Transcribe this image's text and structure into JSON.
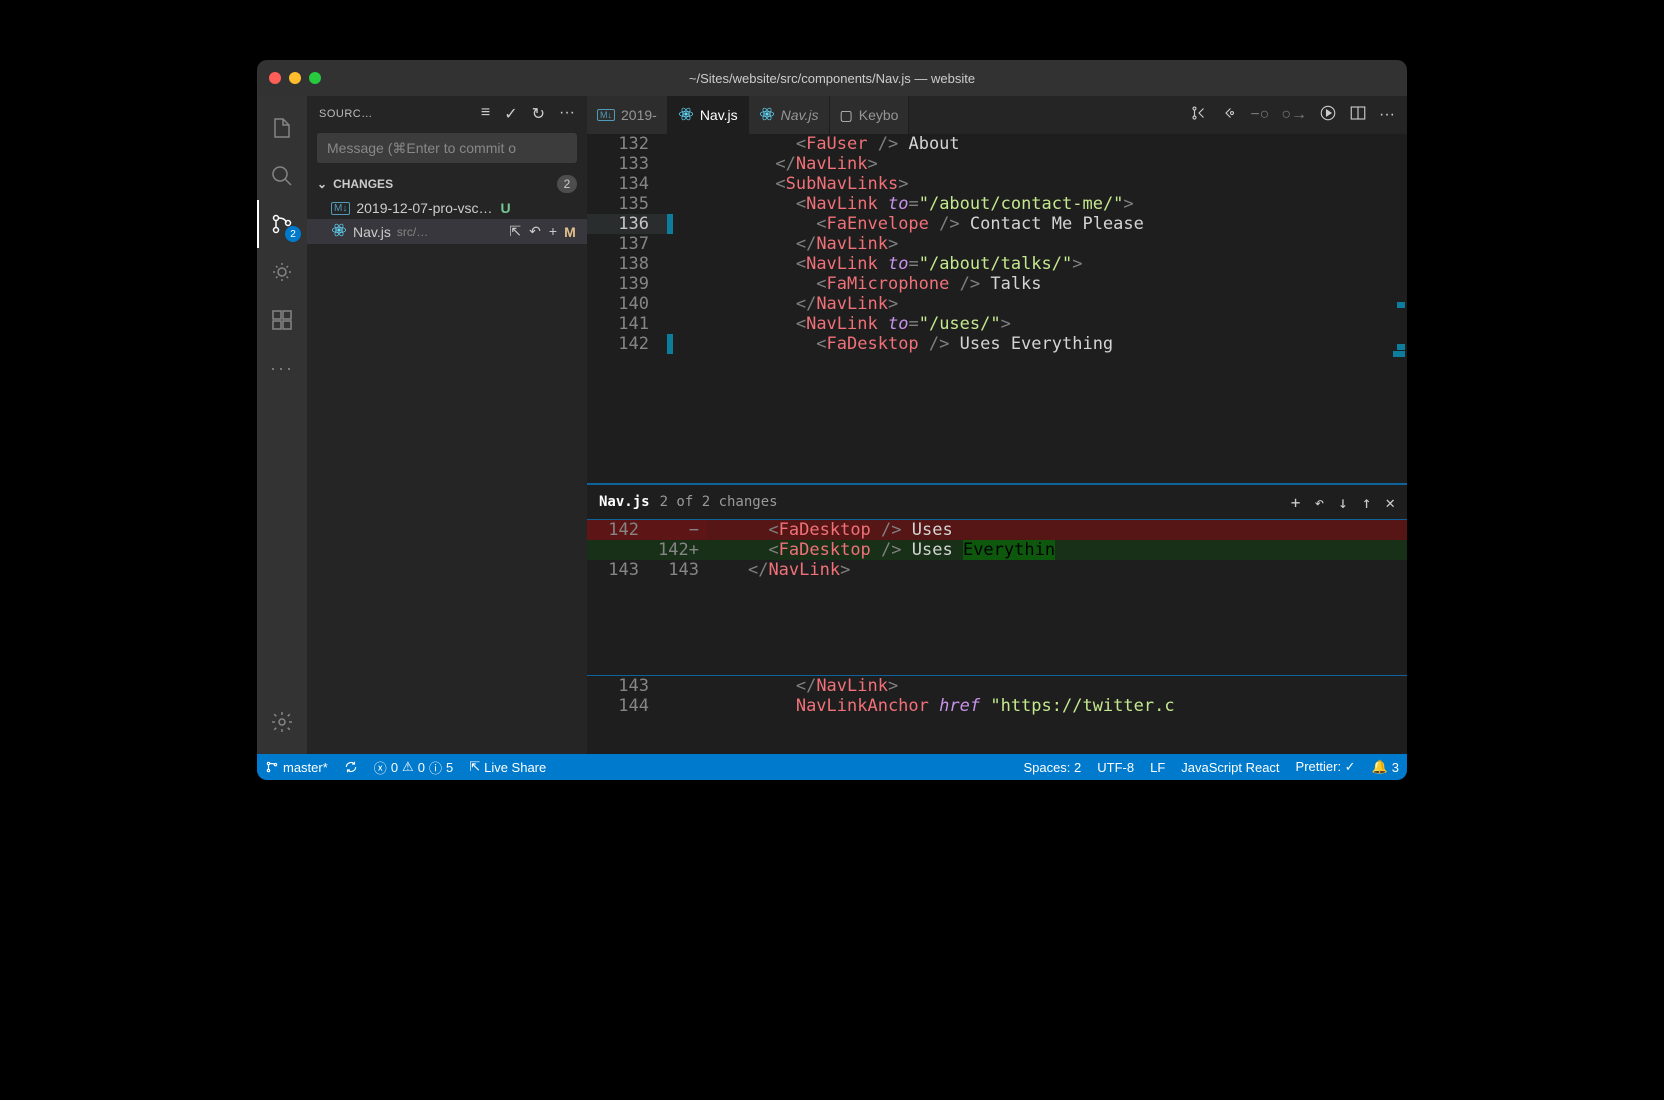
{
  "window": {
    "title": "~/Sites/website/src/components/Nav.js — website"
  },
  "activity": {
    "scm_badge": "2"
  },
  "sidebar": {
    "title": "SOURC…",
    "commit_placeholder": "Message (⌘Enter to commit o",
    "changes_label": "CHANGES",
    "changes_count": "2",
    "files": [
      {
        "name": "2019-12-07-pro-vsc…",
        "status": "U",
        "path": ""
      },
      {
        "name": "Nav.js",
        "status": "M",
        "path": "src/…"
      }
    ]
  },
  "tabs": [
    {
      "label": "2019-"
    },
    {
      "label": "Nav.js"
    },
    {
      "label": "Nav.js"
    },
    {
      "label": "Keybo"
    }
  ],
  "editor": {
    "lines": [
      {
        "n": "132",
        "indent": "            ",
        "html": "<span class='tg'>&lt;</span><span class='cm'>FaUser</span> <span class='tg'>/&gt;</span><span class='tx'> About</span>"
      },
      {
        "n": "133",
        "indent": "          ",
        "html": "<span class='tg'>&lt;/</span><span class='cm'>NavLink</span><span class='tg'>&gt;</span>"
      },
      {
        "n": "134",
        "indent": "          ",
        "html": "<span class='tg'>&lt;</span><span class='cm'>SubNavLinks</span><span class='tg'>&gt;</span>"
      },
      {
        "n": "135",
        "indent": "            ",
        "html": "<span class='tg'>&lt;</span><span class='cm'>NavLink</span> <span class='at'>to</span><span class='tg'>=</span><span class='st'>\"/about/contact-me/\"</span><span class='tg'>&gt;</span>"
      },
      {
        "n": "136",
        "hl": true,
        "deco": "mod",
        "indent": "              ",
        "html": "<span class='tg'>&lt;</span><span class='cm'>FaEnvelope</span> <span class='tg'>/&gt;</span><span class='tx'> Contact Me Please</span>"
      },
      {
        "n": "137",
        "indent": "            ",
        "html": "<span class='tg'>&lt;/</span><span class='cm'>NavLink</span><span class='tg'>&gt;</span>"
      },
      {
        "n": "138",
        "indent": "            ",
        "html": "<span class='tg'>&lt;</span><span class='cm'>NavLink</span> <span class='at'>to</span><span class='tg'>=</span><span class='st'>\"/about/talks/\"</span><span class='tg'>&gt;</span>"
      },
      {
        "n": "139",
        "indent": "              ",
        "html": "<span class='tg'>&lt;</span><span class='cm'>FaMicrophone</span> <span class='tg'>/&gt;</span><span class='tx'> Talks</span>"
      },
      {
        "n": "140",
        "indent": "            ",
        "html": "<span class='tg'>&lt;/</span><span class='cm'>NavLink</span><span class='tg'>&gt;</span>"
      },
      {
        "n": "141",
        "indent": "            ",
        "html": "<span class='tg'>&lt;</span><span class='cm'>NavLink</span> <span class='at'>to</span><span class='tg'>=</span><span class='st'>\"/uses/\"</span><span class='tg'>&gt;</span>"
      },
      {
        "n": "142",
        "deco": "mod",
        "indent": "              ",
        "html": "<span class='tg'>&lt;</span><span class='cm'>FaDesktop</span> <span class='tg'>/&gt;</span><span class='tx'> Uses Everything</span>"
      }
    ]
  },
  "diff": {
    "file": "Nav.js",
    "info": "2 of 2 changes",
    "lines": [
      {
        "a": "142",
        "b": "",
        "sign": "−",
        "kind": "removed",
        "html": "      <span class='tg'>&lt;</span><span class='cm'>FaDesktop</span> <span class='tg'>/&gt;</span><span class='tx'> Uses</span>"
      },
      {
        "a": "",
        "b": "142",
        "sign": "+",
        "kind": "added",
        "html": "      <span class='tg'>&lt;</span><span class='cm'>FaDesktop</span> <span class='tg'>/&gt;</span><span class='tx'> Uses </span><span class='added-hl'>Everythin</span>"
      },
      {
        "a": "143",
        "b": "143",
        "sign": "",
        "kind": "ctx",
        "html": "    <span class='tg'>&lt;/</span><span class='cm'>NavLink</span><span class='tg'>&gt;</span>"
      }
    ],
    "after": [
      {
        "n": "143",
        "html": "            <span class='tg'>&lt;/</span><span class='cm'>NavLink</span><span class='tg'>&gt;</span>"
      },
      {
        "n": "144",
        "html": "            <span class='cm'>NavLinkAnchor</span> <span class='at'>href</span> <span class='st'>\"https://twitter.c</span>"
      }
    ]
  },
  "status": {
    "branch": "master*",
    "errors": "0",
    "warnings": "0",
    "info": "5",
    "live_share": "Live Share",
    "spaces": "Spaces: 2",
    "encoding": "UTF-8",
    "eol": "LF",
    "lang": "JavaScript React",
    "prettier": "Prettier: ✓",
    "bell": "3"
  }
}
